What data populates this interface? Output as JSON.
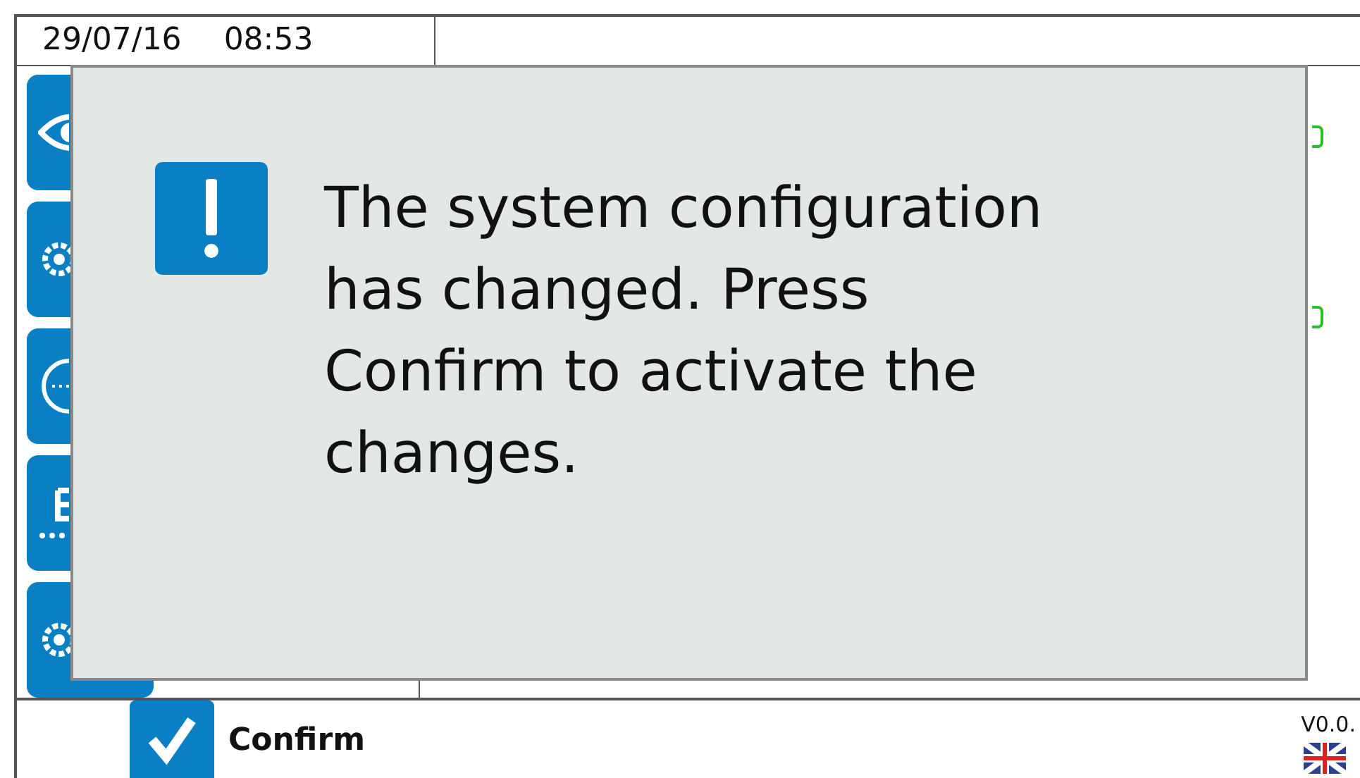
{
  "header": {
    "date": "29/07/16",
    "time": "08:53"
  },
  "sidebar": {
    "buttons": [
      {
        "kind": "eye"
      },
      {
        "kind": "gear"
      },
      {
        "kind": "clock"
      },
      {
        "kind": "letter"
      },
      {
        "kind": "gear"
      }
    ]
  },
  "dialog": {
    "message": "The system configuration has changed. Press Confirm to activate the changes."
  },
  "footer": {
    "confirm_button": "Confirm",
    "version": "V0.0."
  }
}
